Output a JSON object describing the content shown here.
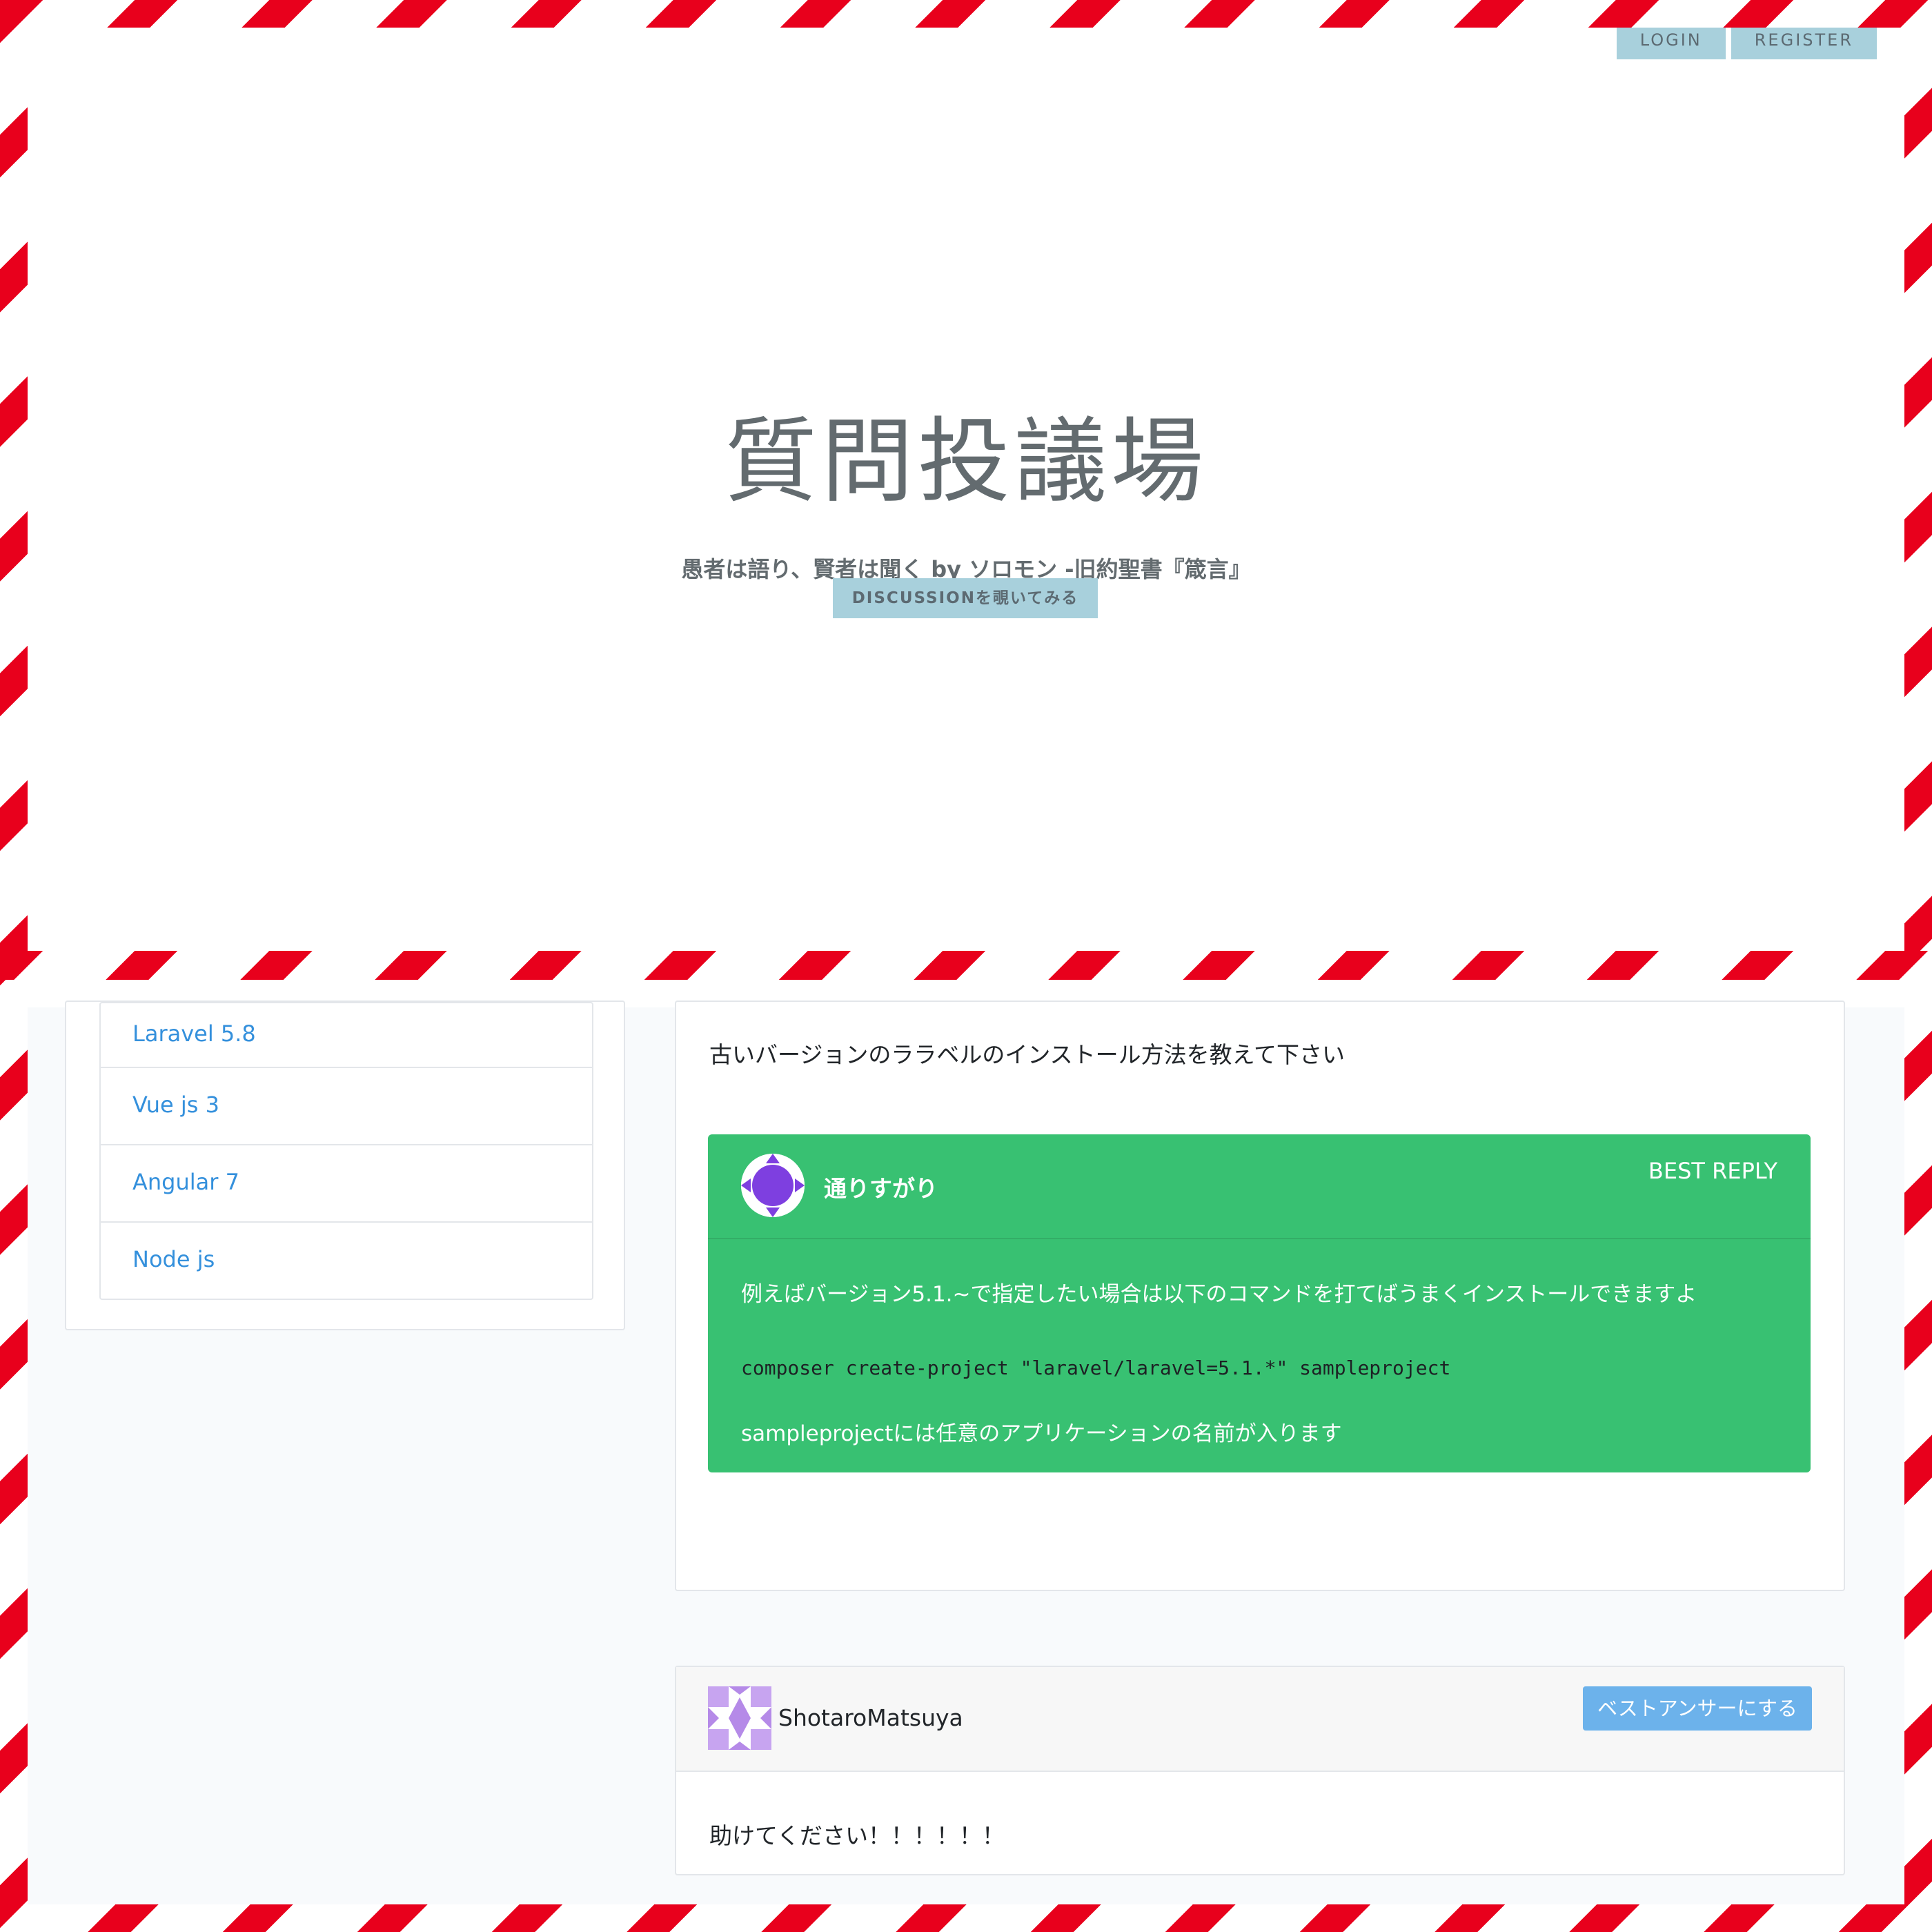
{
  "nav": {
    "login": "LOGIN",
    "register": "REGISTER"
  },
  "hero": {
    "title": "質問投議場",
    "subtitle": "愚者は語り、賢者は聞く by ソロモン -旧約聖書『箴言』",
    "button": "DISCUSSIONを覗いてみる"
  },
  "sidebar": {
    "items": [
      {
        "label": "Laravel 5.8"
      },
      {
        "label": "Vue js 3"
      },
      {
        "label": "Angular 7"
      },
      {
        "label": "Node js"
      }
    ]
  },
  "question": {
    "body": "古いバージョンのララベルのインストール方法を教えて下さい"
  },
  "best_reply": {
    "user": "通りすがり",
    "label": "BEST REPLY",
    "line1": "例えばバージョン5.1.~で指定したい場合は以下のコマンドを打てばうまくインストールできますよ",
    "code": "composer create-project \"laravel/laravel=5.1.*\" sampleproject",
    "line3": "sampleprojectには任意のアプリケーションの名前が入ります"
  },
  "reply": {
    "user": "ShotaroMatsuya",
    "button": "ベストアンサーにする",
    "body": "助けてください！！！！！！"
  },
  "colors": {
    "accent_blue": "#3490dc",
    "best_green": "#38c172",
    "button_blue": "#6cb2eb",
    "hero_button": "#a8d0dc",
    "stripe_red": "#e8001c"
  }
}
